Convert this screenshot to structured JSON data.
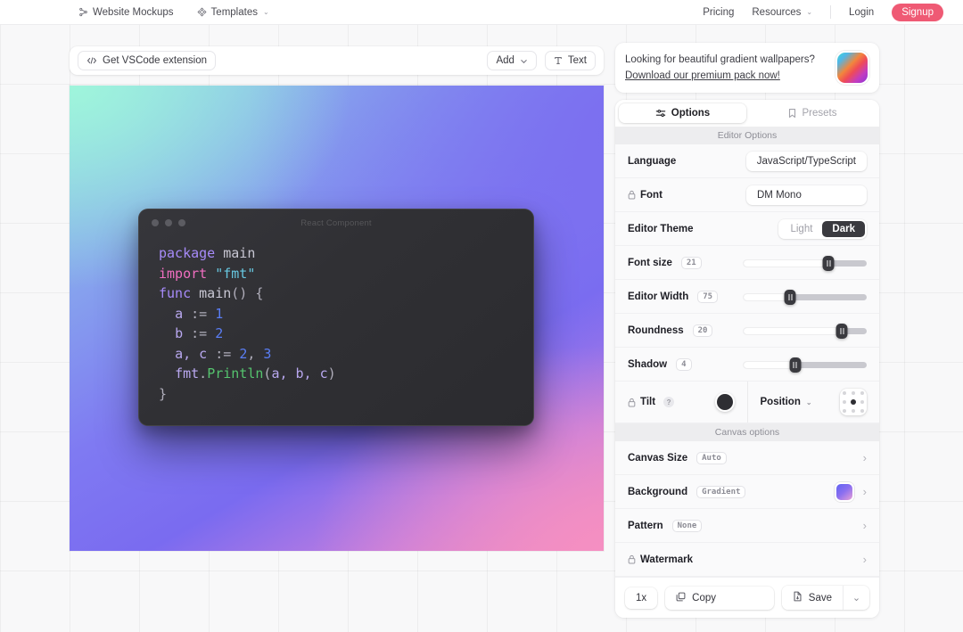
{
  "navbar": {
    "left_items": [
      {
        "label": "Website Mockups",
        "icon": "share-nodes-icon",
        "caret": false
      },
      {
        "label": "Templates",
        "icon": "diamond-grid-icon",
        "caret": true
      }
    ],
    "right_items": [
      {
        "label": "Pricing",
        "caret": false
      },
      {
        "label": "Resources",
        "caret": true
      },
      {
        "label": "Login",
        "caret": false
      }
    ],
    "signup_label": "Signup",
    "signup_color": "#ef5a74",
    "caret_glyph": "⌄"
  },
  "toolbar": {
    "vscode_label": "Get VSCode extension",
    "vscode_icon": "code-brackets-icon",
    "add_label": "Add",
    "add_icon": "chevron-down-icon",
    "text_label": "Text",
    "text_icon": "text-tool-icon"
  },
  "promo": {
    "line1": "Looking for beautiful gradient wallpapers?",
    "link": "Download our premium pack now!",
    "thumb_icon": "gradient-thumbnail"
  },
  "tabs": [
    {
      "label": "Options",
      "icon": "sliders-icon",
      "active": true
    },
    {
      "label": "Presets",
      "icon": "bookmark-icon",
      "active": false
    }
  ],
  "editor_options": {
    "section_title": "Editor Options",
    "language": {
      "label": "Language",
      "value": "JavaScript/TypeScript"
    },
    "font": {
      "label": "Font",
      "value": "DM Mono",
      "locked": true,
      "lock_icon": "lock-icon"
    },
    "theme": {
      "label": "Editor Theme",
      "options": [
        "Light",
        "Dark"
      ],
      "selected": "Dark"
    },
    "sliders": [
      {
        "label": "Font size",
        "value": "21",
        "percent": 69
      },
      {
        "label": "Editor Width",
        "value": "75",
        "percent": 38
      },
      {
        "label": "Roundness",
        "value": "20",
        "percent": 80
      },
      {
        "label": "Shadow",
        "value": "4",
        "percent": 42
      }
    ],
    "tilt": {
      "label": "Tilt",
      "locked": true,
      "lock_icon": "lock-icon",
      "help_glyph": "?",
      "swatch_color": "#2e2e33"
    },
    "position": {
      "label": "Position",
      "caret": "⌄",
      "icon": "position-grid-icon",
      "selected_cell": 4
    }
  },
  "canvas_options": {
    "section_title": "Canvas options",
    "rows": [
      {
        "label": "Canvas Size",
        "pill": "Auto",
        "locked": false,
        "swatch": false
      },
      {
        "label": "Background",
        "pill": "Gradient",
        "locked": false,
        "swatch": true
      },
      {
        "label": "Pattern",
        "pill": "None",
        "locked": false,
        "swatch": false
      },
      {
        "label": "Watermark",
        "pill": "",
        "locked": true,
        "swatch": false
      }
    ],
    "chevron_glyph": "›"
  },
  "action_bar": {
    "scale_label": "1x",
    "copy_label": "Copy",
    "copy_icon": "copy-icon",
    "save_label": "Save",
    "save_icon": "file-download-icon",
    "caret_glyph": "⌄"
  },
  "code_window": {
    "title": "React Component",
    "dots": [
      "#5c5c62",
      "#5c5c62",
      "#5c5c62"
    ],
    "lines": [
      [
        {
          "t": "package",
          "c": "k-kw"
        },
        {
          "t": " ",
          "c": "k-plain"
        },
        {
          "t": "main",
          "c": "k-plain"
        }
      ],
      [
        {
          "t": "import",
          "c": "k-kw2"
        },
        {
          "t": " ",
          "c": "k-plain"
        },
        {
          "t": "\"fmt\"",
          "c": "k-str"
        }
      ],
      [
        {
          "t": "func",
          "c": "k-kw"
        },
        {
          "t": " ",
          "c": "k-plain"
        },
        {
          "t": "main",
          "c": "k-plain"
        },
        {
          "t": "() {",
          "c": "k-punc"
        }
      ],
      [
        {
          "t": "  ",
          "c": "k-plain"
        },
        {
          "t": "a",
          "c": "k-var"
        },
        {
          "t": " := ",
          "c": "k-punc"
        },
        {
          "t": "1",
          "c": "k-num"
        }
      ],
      [
        {
          "t": "  ",
          "c": "k-plain"
        },
        {
          "t": "b",
          "c": "k-var"
        },
        {
          "t": " := ",
          "c": "k-punc"
        },
        {
          "t": "2",
          "c": "k-num"
        }
      ],
      [
        {
          "t": "  ",
          "c": "k-plain"
        },
        {
          "t": "a, c",
          "c": "k-var"
        },
        {
          "t": " := ",
          "c": "k-punc"
        },
        {
          "t": "2",
          "c": "k-num"
        },
        {
          "t": ", ",
          "c": "k-punc"
        },
        {
          "t": "3",
          "c": "k-num"
        }
      ],
      [
        {
          "t": "  ",
          "c": "k-plain"
        },
        {
          "t": "fmt",
          "c": "k-var"
        },
        {
          "t": ".",
          "c": "k-punc"
        },
        {
          "t": "Println",
          "c": "k-fn"
        },
        {
          "t": "(",
          "c": "k-punc"
        },
        {
          "t": "a, b, c",
          "c": "k-var"
        },
        {
          "t": ")",
          "c": "k-punc"
        }
      ],
      [
        {
          "t": "}",
          "c": "k-punc"
        }
      ]
    ]
  },
  "canvas_gradient": {
    "top_left": "#9ff5db",
    "top_right": "#7b6ef0",
    "bottom_left": "#6a63f0",
    "bottom_right": "#ef8fc0",
    "mid": "#8fd4e8"
  }
}
